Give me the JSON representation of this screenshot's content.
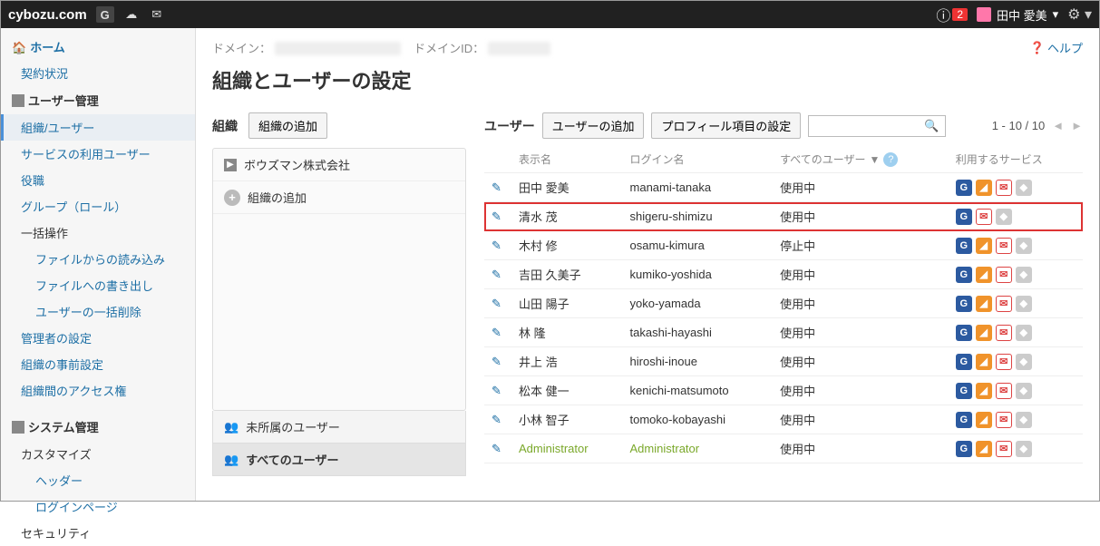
{
  "topbar": {
    "brand": "cybozu.com",
    "notif_count": "2",
    "username": "田中 愛美"
  },
  "sidebar": {
    "home": "ホーム",
    "contract": "契約状況",
    "user_mgmt_header": "ユーザー管理",
    "org_users": "組織/ユーザー",
    "service_users": "サービスの利用ユーザー",
    "positions": "役職",
    "groups": "グループ（ロール）",
    "bulk": "一括操作",
    "bulk_import": "ファイルからの読み込み",
    "bulk_export": "ファイルへの書き出し",
    "bulk_delete": "ユーザーの一括削除",
    "admin_settings": "管理者の設定",
    "org_presettings": "組織の事前設定",
    "org_access": "組織間のアクセス権",
    "system_header": "システム管理",
    "customize": "カスタマイズ",
    "header_link": "ヘッダー",
    "login_page": "ログインページ",
    "security": "セキュリティ"
  },
  "main": {
    "domain_label": "ドメイン：",
    "domain_id_label": "ドメインID：",
    "help": "ヘルプ",
    "title": "組織とユーザーの設定",
    "org_label": "組織",
    "add_org_btn": "組織の追加",
    "org_root": "ボウズマン株式会社",
    "add_org_inline": "組織の追加",
    "unassigned": "未所属のユーザー",
    "all_users": "すべてのユーザー",
    "user_label": "ユーザー",
    "add_user_btn": "ユーザーの追加",
    "profile_fields_btn": "プロフィール項目の設定",
    "pager": "1 - 10 / 10",
    "th_display": "表示名",
    "th_login": "ログイン名",
    "th_filter": "すべてのユーザー",
    "th_services": "利用するサービス",
    "users": [
      {
        "display": "田中 愛美",
        "login": "manami-tanaka",
        "status": "使用中",
        "svc": [
          "g",
          "o",
          "m",
          "s"
        ],
        "highlight": false,
        "admin": false
      },
      {
        "display": "清水 茂",
        "login": "shigeru-shimizu",
        "status": "使用中",
        "svc": [
          "g",
          "m",
          "s"
        ],
        "highlight": true,
        "admin": false
      },
      {
        "display": "木村 修",
        "login": "osamu-kimura",
        "status": "停止中",
        "svc": [
          "g",
          "o",
          "m",
          "s"
        ],
        "highlight": false,
        "admin": false
      },
      {
        "display": "吉田 久美子",
        "login": "kumiko-yoshida",
        "status": "使用中",
        "svc": [
          "g",
          "o",
          "m",
          "s"
        ],
        "highlight": false,
        "admin": false
      },
      {
        "display": "山田 陽子",
        "login": "yoko-yamada",
        "status": "使用中",
        "svc": [
          "g",
          "o",
          "m",
          "s"
        ],
        "highlight": false,
        "admin": false
      },
      {
        "display": "林 隆",
        "login": "takashi-hayashi",
        "status": "使用中",
        "svc": [
          "g",
          "o",
          "m",
          "s"
        ],
        "highlight": false,
        "admin": false
      },
      {
        "display": "井上 浩",
        "login": "hiroshi-inoue",
        "status": "使用中",
        "svc": [
          "g",
          "o",
          "m",
          "s"
        ],
        "highlight": false,
        "admin": false
      },
      {
        "display": "松本 健一",
        "login": "kenichi-matsumoto",
        "status": "使用中",
        "svc": [
          "g",
          "o",
          "m",
          "s"
        ],
        "highlight": false,
        "admin": false
      },
      {
        "display": "小林 智子",
        "login": "tomoko-kobayashi",
        "status": "使用中",
        "svc": [
          "g",
          "o",
          "m",
          "s"
        ],
        "highlight": false,
        "admin": false
      },
      {
        "display": "Administrator",
        "login": "Administrator",
        "status": "使用中",
        "svc": [
          "g",
          "o",
          "m",
          "s"
        ],
        "highlight": false,
        "admin": true
      }
    ]
  }
}
